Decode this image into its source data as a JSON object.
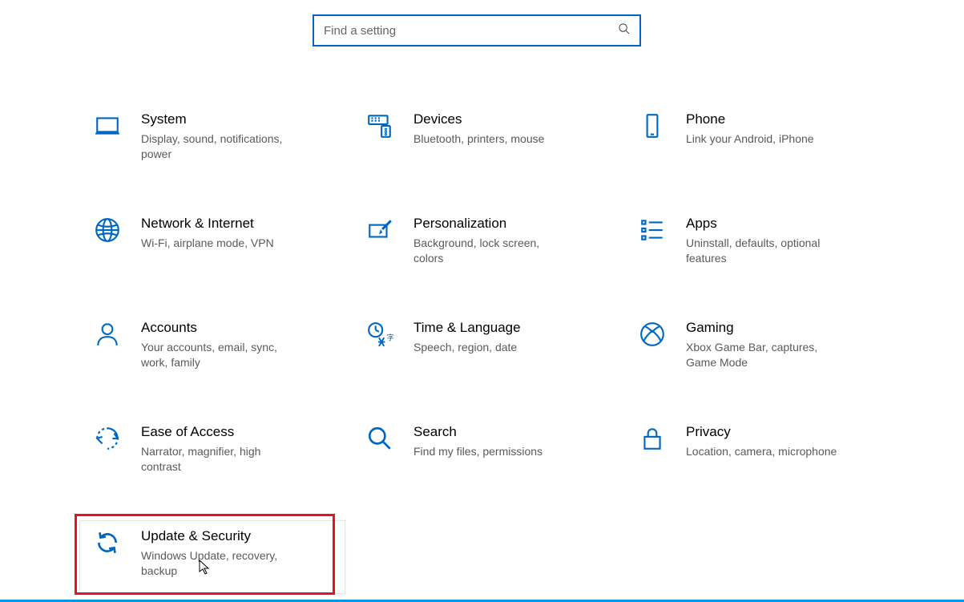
{
  "search": {
    "placeholder": "Find a setting"
  },
  "tiles": {
    "system": {
      "title": "System",
      "sub": "Display, sound, notifications, power"
    },
    "devices": {
      "title": "Devices",
      "sub": "Bluetooth, printers, mouse"
    },
    "phone": {
      "title": "Phone",
      "sub": "Link your Android, iPhone"
    },
    "network": {
      "title": "Network & Internet",
      "sub": "Wi-Fi, airplane mode, VPN"
    },
    "personalization": {
      "title": "Personalization",
      "sub": "Background, lock screen, colors"
    },
    "apps": {
      "title": "Apps",
      "sub": "Uninstall, defaults, optional features"
    },
    "accounts": {
      "title": "Accounts",
      "sub": "Your accounts, email, sync, work, family"
    },
    "time": {
      "title": "Time & Language",
      "sub": "Speech, region, date"
    },
    "gaming": {
      "title": "Gaming",
      "sub": "Xbox Game Bar, captures, Game Mode"
    },
    "ease": {
      "title": "Ease of Access",
      "sub": "Narrator, magnifier, high contrast"
    },
    "search": {
      "title": "Search",
      "sub": "Find my files, permissions"
    },
    "privacy": {
      "title": "Privacy",
      "sub": "Location, camera, microphone"
    },
    "update": {
      "title": "Update & Security",
      "sub": "Windows Update, recovery, backup"
    }
  }
}
